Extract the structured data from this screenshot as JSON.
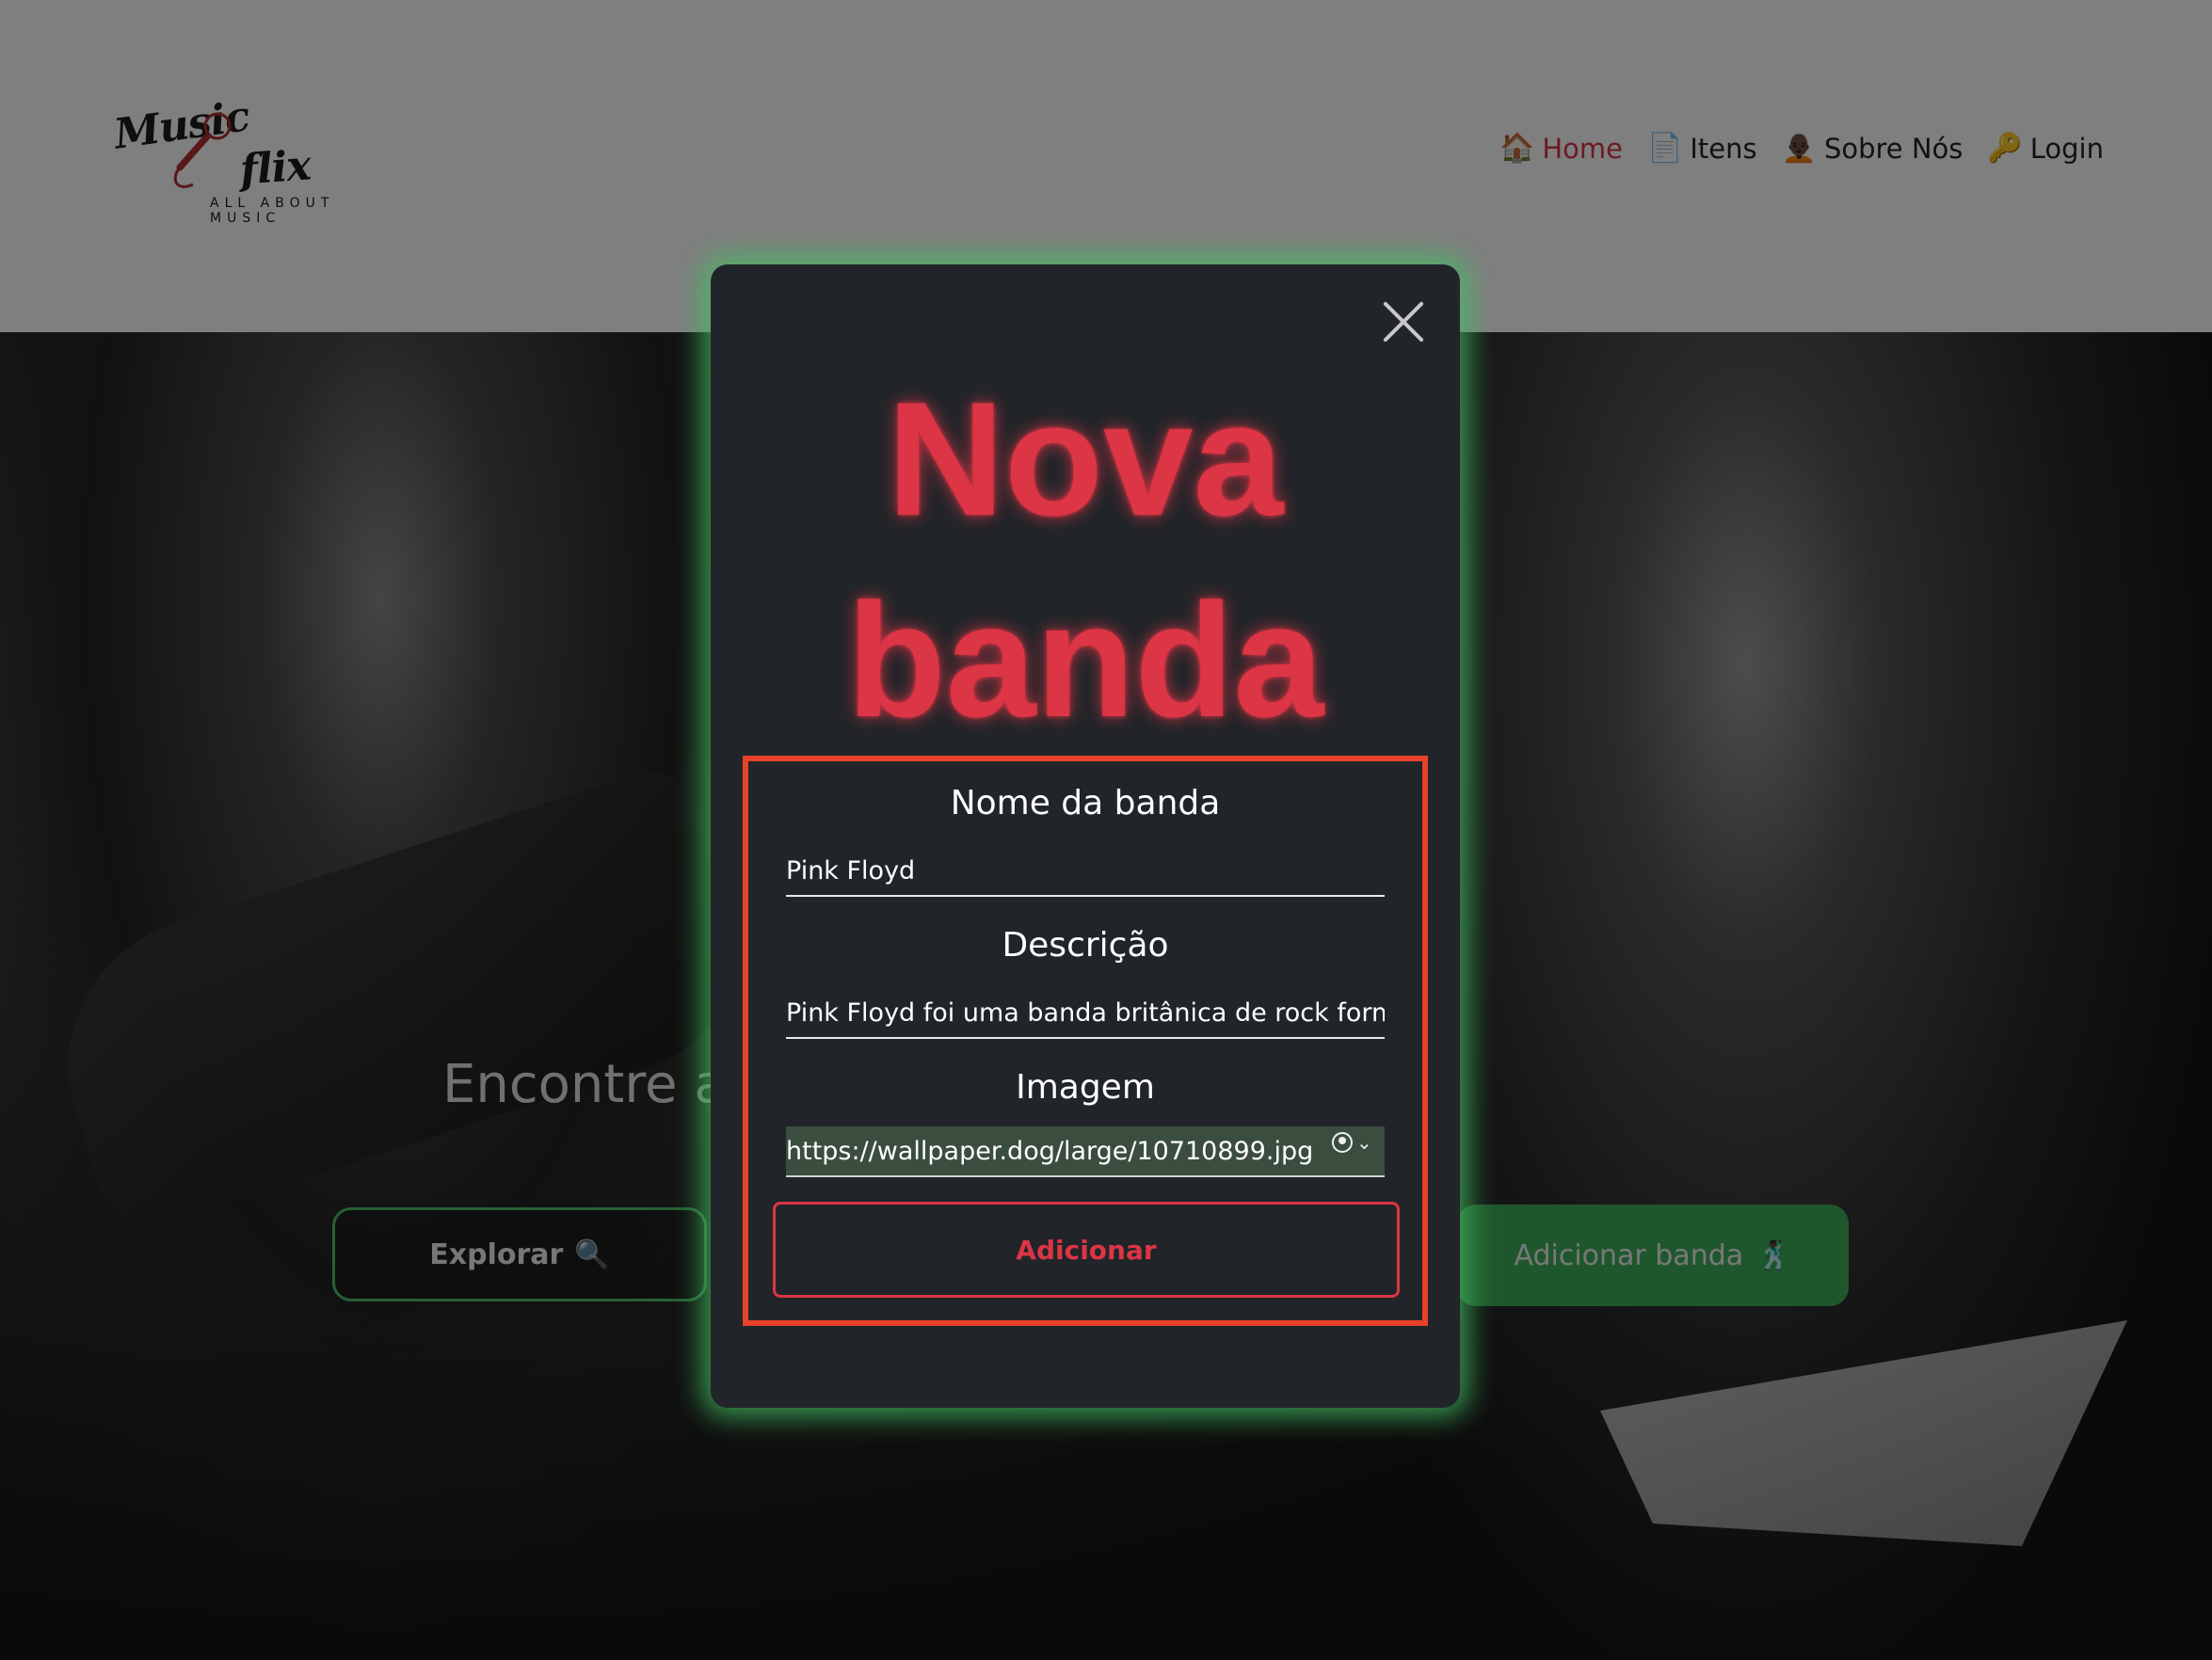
{
  "header": {
    "logo": {
      "line1": "Music",
      "line2": "flix",
      "tagline": "ALL ABOUT MUSIC"
    },
    "nav": [
      {
        "label": "Home",
        "icon": "🏠",
        "active": true
      },
      {
        "label": "Itens",
        "icon": "📄",
        "active": false
      },
      {
        "label": "Sobre Nós",
        "icon": "🧑🏿‍🦲",
        "active": false
      },
      {
        "label": "Login",
        "icon": "🔑",
        "active": false
      }
    ]
  },
  "hero": {
    "headline": "Encontre a sua banda favorita",
    "headline_emojis": "🎸 🧑🏾‍🦱 🎙️",
    "explore_button": {
      "label": "Explorar",
      "icon": "🔍"
    },
    "add_band_button": {
      "label": "Adicionar banda",
      "icon": "🕺🏿"
    }
  },
  "modal": {
    "title_line1": "Nova",
    "title_line2": "banda",
    "fields": {
      "name": {
        "label": "Nome da banda",
        "value": "Pink Floyd"
      },
      "description": {
        "label": "Descrição",
        "value": "Pink Floyd foi uma banda britânica de rock forma"
      },
      "image": {
        "label": "Imagem",
        "value": "https://wallpaper.dog/large/10710899.jpg"
      }
    },
    "submit_label": "Adicionar"
  },
  "colors": {
    "accent_red": "#dc3545",
    "accent_green": "#44be62",
    "modal_bg": "#212529",
    "highlight_border": "#e8422a"
  }
}
